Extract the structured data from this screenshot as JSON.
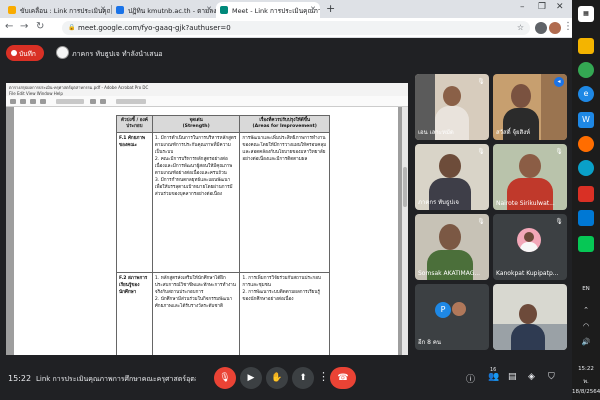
{
  "browser": {
    "tabs": [
      {
        "label": "ขับเคลื่อน : Link การประเมินคุณภาพ",
        "active": false
      },
      {
        "label": "ปฏิทิน kmutnb.ac.th - ตามลงข้อมูลแ",
        "active": false
      },
      {
        "label": "Meet - Link การประเมินคุณภาพการ",
        "active": true
      }
    ],
    "url": "meet.google.com/fyo-gaaq-gjk?authuser=0"
  },
  "meet": {
    "record_label": "บันทึก",
    "presenter_name": "ภาคกร ทับธูปเจ ทำลังนำเสนอ",
    "time": "15:22",
    "meeting_title": "Link การประเมินคุณภาพการศึกษาคณะครุศาสตร์อุตส...",
    "participant_count": "16",
    "tiles": [
      {
        "name": "เอน เลาะหมัด"
      },
      {
        "name": "สวัสดิ์ จุ้ยสิงห์"
      },
      {
        "name": "ภาคกร ทับธูปเจ"
      },
      {
        "name": "Nairote Sirikulwat..."
      },
      {
        "name": "Somsak AKATIMAG..."
      },
      {
        "name": "Kanokpat Kupipatp..."
      },
      {
        "name": "อีก 8 คน",
        "initial": "P"
      }
    ]
  },
  "document": {
    "reader_title": "ตารางสรุปผลการประเมิน-ครุศาสตร์อุตสาหกรรม.pdf - Adobe Acrobat Pro DC",
    "reader_menu": "File   Edit   View   Window   Help",
    "headers": {
      "col1": "ตัวบ่งชี้ / องค์ประกอบ",
      "col2": "จุดเด่น",
      "col2_en": "(Strength)",
      "col3": "เรื่องที่ควรปรับปรุงให้ดีขึ้น",
      "col3_en": "(Areas for Improvement)"
    },
    "rows": [
      {
        "code": "F.1 ศักยภาพของคณะ",
        "strength": "1. มีการดำเนินการในการบริหารหลักสูตรตามเกณฑ์การประกันคุณภาพที่มีความเป็นระบบ\n2. คณะมีการบริหารหลักสูตรอย่างต่อเนื่องและมีการพัฒนาผู้สอนให้มีคุณภาพตามเกณฑ์อย่างต่อเนื่องและครบถ้วน\n3. มีการกำหนดกลยุทธ์และแผนพัฒนาเพื่อให้บรรลุตามเป้าหมายโดยผ่านการมีส่วนร่วมของบุคลากรอย่างต่อเนื่อง",
        "improvement": "การพัฒนาและเพิ่มประสิทธิภาพการทำงานของคณะโดยให้มีการวางแผนให้ครอบคลุมและสอดคล้องกับนโยบายของมหาวิทยาลัยอย่างต่อเนื่องและมีการติดตามผล"
      },
      {
        "code": "F.2 สภาพการเรียนรู้ของนักศึกษา",
        "strength": "1. หลักสูตรส่งเสริมให้นักศึกษาได้ฝึกประสบการณ์วิชาชีพและทักษะการทำงานจริงกับสถานประกอบการ\n2. นักศึกษามีส่วนร่วมในกิจกรรมพัฒนาศักยภาพและได้รับรางวัลระดับชาติ",
        "improvement": "1. การเพิ่มการวิจัยร่วมกับสถานประกอบการและชุมชน\n2. การพัฒนาระบบติดตามผลการเรียนรู้ของนักศึกษาอย่างต่อเนื่อง"
      }
    ]
  }
}
